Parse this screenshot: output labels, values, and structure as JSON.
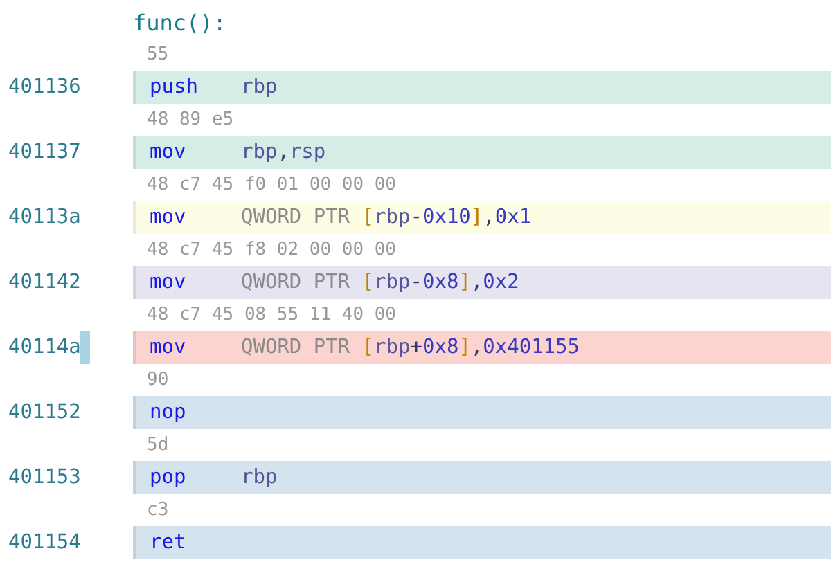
{
  "function_label": "func():",
  "rows": [
    {
      "bytes": "55",
      "address": "401136",
      "mnemonic": "push",
      "color": "#d5ede7",
      "current": false,
      "operands": [
        {
          "kind": "reg",
          "text": "rbp"
        }
      ]
    },
    {
      "bytes": "48 89 e5",
      "address": "401137",
      "mnemonic": "mov",
      "color": "#d5ede7",
      "current": false,
      "operands": [
        {
          "kind": "reg",
          "text": "rbp"
        },
        {
          "kind": "punct",
          "text": ","
        },
        {
          "kind": "reg",
          "text": "rsp"
        }
      ]
    },
    {
      "bytes": "48 c7 45 f0 01 00 00 00",
      "address": "40113a",
      "mnemonic": "mov",
      "color": "#fdfde6",
      "current": false,
      "operands": [
        {
          "kind": "kw",
          "text": "QWORD PTR "
        },
        {
          "kind": "bracket",
          "text": "["
        },
        {
          "kind": "reg",
          "text": "rbp"
        },
        {
          "kind": "punct",
          "text": "-"
        },
        {
          "kind": "num",
          "text": "0x10"
        },
        {
          "kind": "bracket",
          "text": "]"
        },
        {
          "kind": "punct",
          "text": ","
        },
        {
          "kind": "num",
          "text": "0x1"
        }
      ]
    },
    {
      "bytes": "48 c7 45 f8 02 00 00 00",
      "address": "401142",
      "mnemonic": "mov",
      "color": "#e6e4f0",
      "current": false,
      "operands": [
        {
          "kind": "kw",
          "text": "QWORD PTR "
        },
        {
          "kind": "bracket",
          "text": "["
        },
        {
          "kind": "reg",
          "text": "rbp"
        },
        {
          "kind": "punct",
          "text": "-"
        },
        {
          "kind": "num",
          "text": "0x8"
        },
        {
          "kind": "bracket",
          "text": "]"
        },
        {
          "kind": "punct",
          "text": ","
        },
        {
          "kind": "num",
          "text": "0x2"
        }
      ]
    },
    {
      "bytes": "48 c7 45 08 55 11 40 00",
      "address": "40114a",
      "mnemonic": "mov",
      "color": "#fbd4d0",
      "current": true,
      "operands": [
        {
          "kind": "kw",
          "text": "QWORD PTR "
        },
        {
          "kind": "bracket",
          "text": "["
        },
        {
          "kind": "reg",
          "text": "rbp"
        },
        {
          "kind": "punct",
          "text": "+"
        },
        {
          "kind": "num",
          "text": "0x8"
        },
        {
          "kind": "bracket",
          "text": "]"
        },
        {
          "kind": "punct",
          "text": ","
        },
        {
          "kind": "num",
          "text": "0x401155"
        }
      ]
    },
    {
      "bytes": "90",
      "address": "401152",
      "mnemonic": "nop",
      "color": "#d5e3ee",
      "current": false,
      "operands": []
    },
    {
      "bytes": "5d",
      "address": "401153",
      "mnemonic": "pop",
      "color": "#d5e3ee",
      "current": false,
      "operands": [
        {
          "kind": "reg",
          "text": "rbp"
        }
      ]
    },
    {
      "bytes": "c3",
      "address": "401154",
      "mnemonic": "ret",
      "color": "#d5e3ee",
      "current": false,
      "operands": []
    }
  ]
}
